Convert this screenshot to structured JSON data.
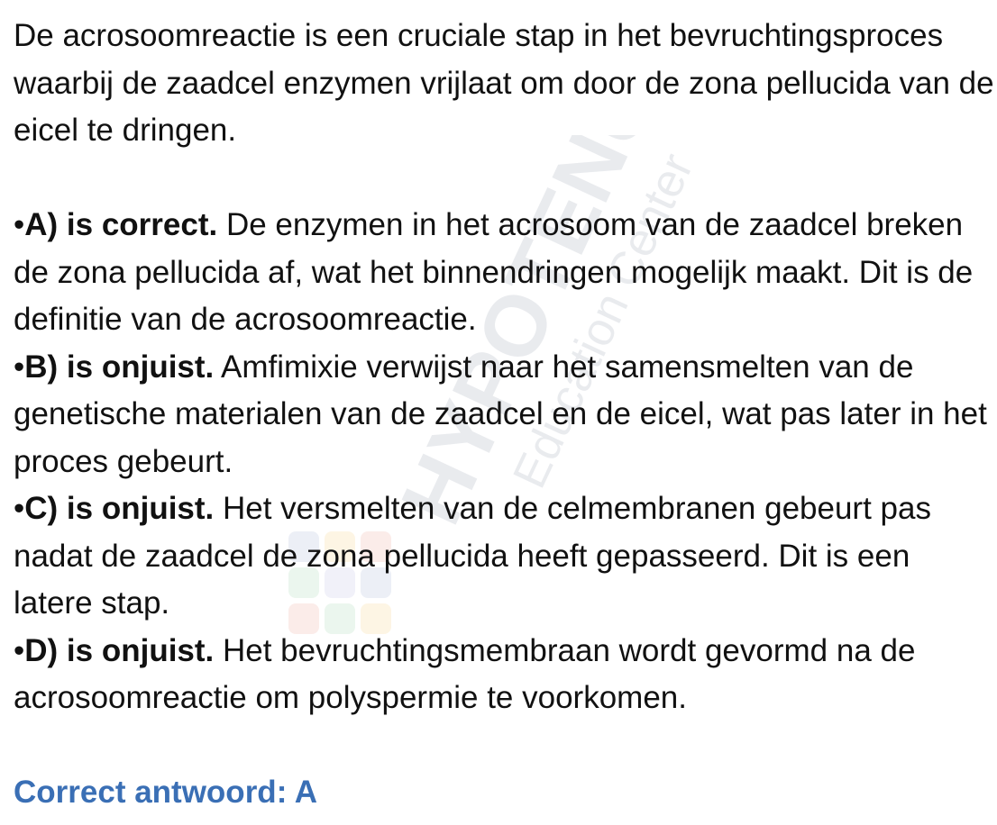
{
  "intro": "De acrosoomreactie is een cruciale stap in het bevruchtingsproces waarbij de zaadcel enzymen vrijlaat om door de zona pellucida van de eicel te dringen.",
  "options": [
    {
      "bullet": "•",
      "label": "A) is correct.",
      "text": " De enzymen in het acrosoom van de zaadcel breken de zona pellucida af, wat het binnendringen mogelijk maakt. Dit is de definitie van de acrosoomreactie."
    },
    {
      "bullet": "•",
      "label": "B) is onjuist.",
      "text": " Amfimixie verwijst naar het samensmelten van de genetische materialen van de zaadcel en de eicel, wat pas later in het proces gebeurt."
    },
    {
      "bullet": "•",
      "label": "C) is onjuist.",
      "text": " Het versmelten van de celmembranen gebeurt pas nadat de zaadcel de zona pellucida heeft gepasseerd. Dit is een latere stap."
    },
    {
      "bullet": "•",
      "label": "D) is onjuist.",
      "text": " Het bevruchtingsmembraan wordt gevormd na de acrosoomreactie om polyspermie te voorkomen."
    }
  ],
  "answer": "Correct antwoord: A",
  "watermark": {
    "brand": "HYPOTENUSE",
    "tagline": "Education Center",
    "colors": [
      "#c9d4e6",
      "#f6c9c2",
      "#c8e6cf",
      "#fbe3b5",
      "#d9d9ef"
    ]
  }
}
